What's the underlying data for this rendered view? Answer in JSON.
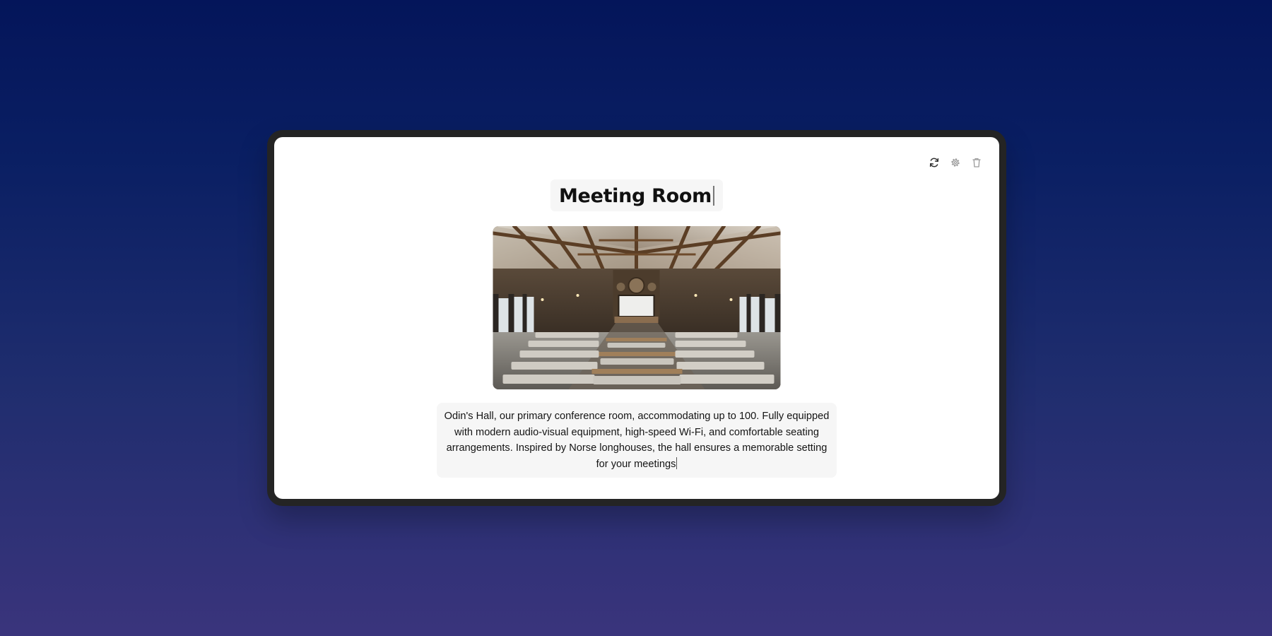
{
  "card": {
    "title": "Meeting Room",
    "image_alt": "Odin's Hall conference room interior",
    "description": "Odin's Hall, our primary conference room, accommodating up to 100. Fully equipped with modern audio-visual equipment, high-speed Wi-Fi, and comfortable seating arrangements. Inspired by Norse longhouses, the hall ensures a memorable setting for your meetings"
  },
  "toolbar": {
    "icons": [
      "refresh-icon",
      "gear-icon",
      "trash-icon"
    ]
  },
  "colors": {
    "background_top": "#04155a",
    "background_bottom": "#3a347c",
    "frame": "#242424",
    "card": "#ffffff",
    "field": "#f6f6f6"
  }
}
